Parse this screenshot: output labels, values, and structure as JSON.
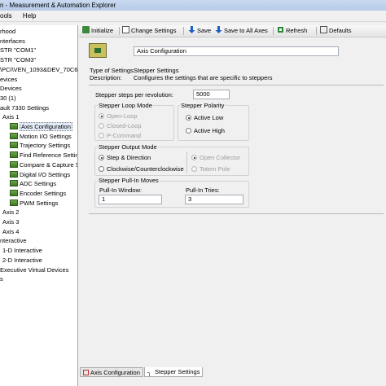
{
  "window": {
    "title": "n - Measurement & Automation Explorer"
  },
  "menu": [
    "ools",
    "Help"
  ],
  "tree": {
    "items": [
      {
        "label": "rhood",
        "icon": false
      },
      {
        "label": "nterfaces",
        "icon": false
      },
      {
        "label": "STR \"COM1\"",
        "icon": false
      },
      {
        "label": "STR \"COM3\"",
        "icon": false
      },
      {
        "label": "\\PCI\\VEN_1093&DEV_70C6&",
        "icon": false
      },
      {
        "label": "evices",
        "icon": false
      },
      {
        "label": " Devices",
        "icon": false
      },
      {
        "label": "30 (1)",
        "icon": false
      },
      {
        "label": "ault 7330 Settings",
        "icon": false
      },
      {
        "label": "Axis 1",
        "icon": false
      },
      {
        "label": "Axis Configuration",
        "icon": true,
        "selected": true
      },
      {
        "label": "Motion I/O Settings",
        "icon": true
      },
      {
        "label": "Trajectory Settings",
        "icon": true
      },
      {
        "label": "Find Reference Settings",
        "icon": true
      },
      {
        "label": "Compare & Capture Set",
        "icon": true
      },
      {
        "label": "Digital I/O Settings",
        "icon": true
      },
      {
        "label": "ADC Settings",
        "icon": true
      },
      {
        "label": "Encoder Settings",
        "icon": true
      },
      {
        "label": "PWM Settings",
        "icon": true
      },
      {
        "label": "Axis 2",
        "icon": false
      },
      {
        "label": "Axis 3",
        "icon": false
      },
      {
        "label": "Axis 4",
        "icon": false
      },
      {
        "label": "nteractive",
        "icon": false
      },
      {
        "label": "1-D Interactive",
        "icon": false
      },
      {
        "label": "2-D Interactive",
        "icon": false
      },
      {
        "label": "Executive Virtual Devices",
        "icon": false
      },
      {
        "label": "s",
        "icon": false
      }
    ]
  },
  "toolbar": {
    "initialize": "Initialize",
    "change_settings": "Change Settings",
    "save": "Save",
    "save_all": "Save to All Axes",
    "refresh": "Refresh",
    "defaults": "Defaults"
  },
  "header": {
    "name_value": "Axis Configuration",
    "type_label": "Type of Settings:",
    "type_value": "Stepper Settings",
    "desc_label": "Description:",
    "desc_value": "Configures the settings that are specific to steppers"
  },
  "settings": {
    "steps_label": "Stepper steps per revolution:",
    "steps_value": "5000",
    "loop_mode": {
      "title": "Stepper Loop Mode",
      "options": [
        "Open-Loop",
        "Closed-Loop",
        "P-Command"
      ]
    },
    "polarity": {
      "title": "Stepper Polarity",
      "options": [
        "Active Low",
        "Active High"
      ]
    },
    "output_mode": {
      "title": "Stepper Output Mode",
      "options": [
        "Step & Direction",
        "Clockwise/Counterclockwise"
      ],
      "drive_options": [
        "Open Collector",
        "Totem Pole"
      ]
    },
    "pullin": {
      "title": "Stepper Pull-In Moves",
      "window_label": "Pull-In Window:",
      "window_value": "1",
      "tries_label": "Pull-In Tries:",
      "tries_value": "3"
    }
  },
  "bottom_tabs": [
    "Axis Configuration",
    "Stepper Settings"
  ]
}
